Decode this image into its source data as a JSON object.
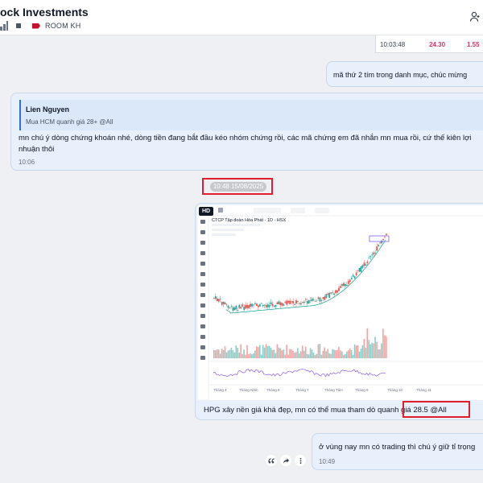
{
  "header": {
    "title": "ock Investments",
    "room_label": "ROOM KH"
  },
  "quote_row": {
    "time": "10:03:48",
    "value1": "24.30",
    "value2": "1.55"
  },
  "messages": [
    {
      "text": "mã thứ 2 tím trong danh mục, chúc mừng"
    },
    {
      "reply_name": "Lien Nguyen",
      "reply_text": "Mua HCM quanh giá 28+ @All",
      "text": "mn chú ý dòng chứng khoán nhé, dòng tiền đang bắt đầu kéo nhóm chứng rồi, các mã chứng em đã nhắn mn mua rồi, cứ thế kiên lợi nhuận thôi",
      "time": "10:06"
    },
    {
      "date_separator": "10:48 15/08/2025",
      "hd_badge": "HD",
      "chart_title": "CTCP Tập đoàn Hòa Phát · 1D · HSX",
      "caption": "HPG xây nền giá khá đẹp, mn có thể mua tham dò quanh giá 28.5 @All"
    },
    {
      "text": "ở vùng nay mn có trading thì chú ý giữ tỉ trọng",
      "time": "10:49"
    }
  ],
  "chart_axis_labels": [
    "Tháng 4",
    "Tháng Năm",
    "Tháng 6",
    "Tháng 7",
    "Tháng Tám",
    "Tháng 9",
    "Tháng 10",
    "Tháng 11"
  ],
  "colors": {
    "up": "#26a69a",
    "down": "#ef5350",
    "accent": "#2f6fd6",
    "highlight": "#e11d2e",
    "mention": "#1d4ed8"
  }
}
